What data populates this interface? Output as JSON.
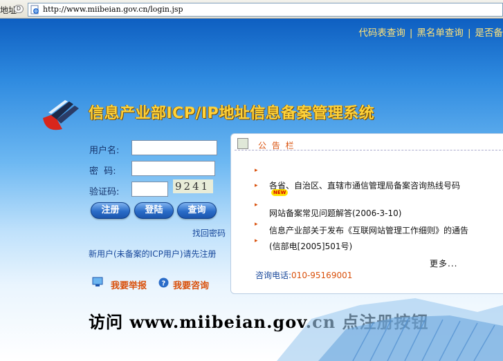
{
  "browser": {
    "address_label": "地址",
    "address_dropdown": "D",
    "url": "http://www.miibeian.gov.cn/login.jsp"
  },
  "topnav": {
    "items": [
      "代码表查询",
      "黑名单查询",
      "是否备"
    ],
    "separator": "|"
  },
  "header": {
    "title": "信息产业部ICP/IP地址信息备案管理系统"
  },
  "login": {
    "username_label": "用户名:",
    "password_label": "密  码:",
    "captcha_label": "验证码:",
    "captcha_code": "9241",
    "buttons": {
      "register": "注册",
      "login": "登陆",
      "query": "查询"
    },
    "recover_password": "找回密码",
    "new_user_hint": "新用户(未备案的ICP用户)请先注册",
    "report_link": "我要举报",
    "consult_link": "我要咨询"
  },
  "notice": {
    "title": "公 告 栏",
    "items": [
      "各省、自治区、直辖市通信管理局备案咨询热线号码",
      "网站备案常见问题解答(2006-3-10)",
      "信息产业部关于发布《互联网站管理工作细则》的通告",
      "(信部电[2005]501号)"
    ],
    "new_badge": "NEW",
    "more": "更多...",
    "phone_label": "咨询电话:",
    "phone_number": "010-95169001"
  },
  "slogan": "访问 www.miibeian.gov.cn 点注册按钮",
  "colors": {
    "accent_orange": "#d9500b",
    "title_gold": "#ffd33a",
    "link_blue": "#17479a"
  }
}
